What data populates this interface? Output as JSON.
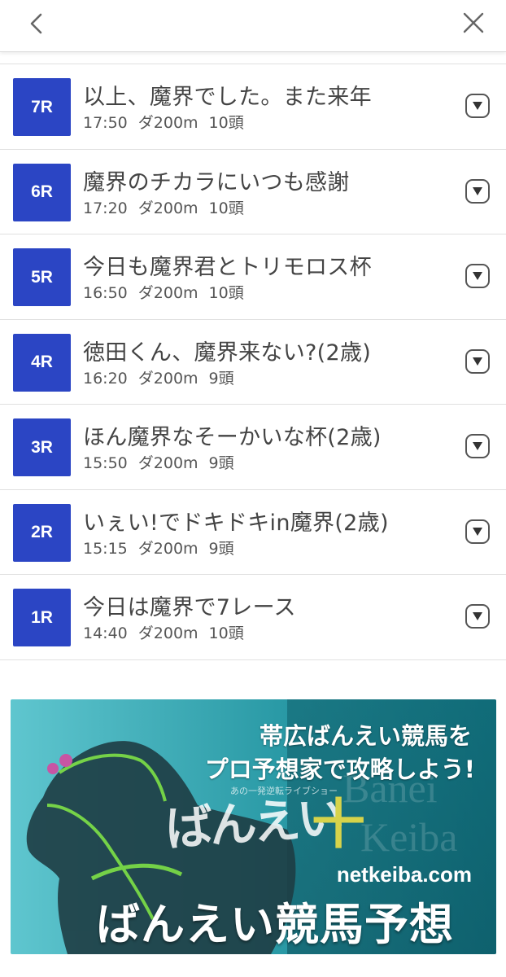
{
  "header": {
    "back_icon": "chevron-left-icon",
    "close_icon": "close-icon"
  },
  "races": [
    {
      "num": "7R",
      "title": "以上、魔界でした。また来年",
      "time": "17:50",
      "course": "ダ200m",
      "runners": "10頭"
    },
    {
      "num": "6R",
      "title": "魔界のチカラにいつも感謝",
      "time": "17:20",
      "course": "ダ200m",
      "runners": "10頭"
    },
    {
      "num": "5R",
      "title": "今日も魔界君とトリモロス杯",
      "time": "16:50",
      "course": "ダ200m",
      "runners": "10頭"
    },
    {
      "num": "4R",
      "title": "徳田くん、魔界来ない?(2歳)",
      "time": "16:20",
      "course": "ダ200m",
      "runners": "9頭"
    },
    {
      "num": "3R",
      "title": "ほん魔界なそーかいな杯(2歳)",
      "time": "15:50",
      "course": "ダ200m",
      "runners": "9頭"
    },
    {
      "num": "2R",
      "title": "いぇい!でドキドキin魔界(2歳)",
      "time": "15:15",
      "course": "ダ200m",
      "runners": "9頭"
    },
    {
      "num": "1R",
      "title": "今日は魔界で7レース",
      "time": "14:40",
      "course": "ダ200m",
      "runners": "10頭"
    }
  ],
  "banner": {
    "tagline_1": "帯広ばんえい競馬を",
    "tagline_2": "プロ予想家で攻略しよう!",
    "logo_text": "ばんえい",
    "logo_kanji": "十",
    "logo_sub": "あの一発逆転ライブショー",
    "watermark_1": "Banei",
    "watermark_2": "Keiba",
    "domain": "netkeiba.com",
    "headline": "ばんえい競馬予想"
  },
  "colors": {
    "race_badge": "#2b45c4",
    "banner_teal": "#2a9aa6"
  }
}
